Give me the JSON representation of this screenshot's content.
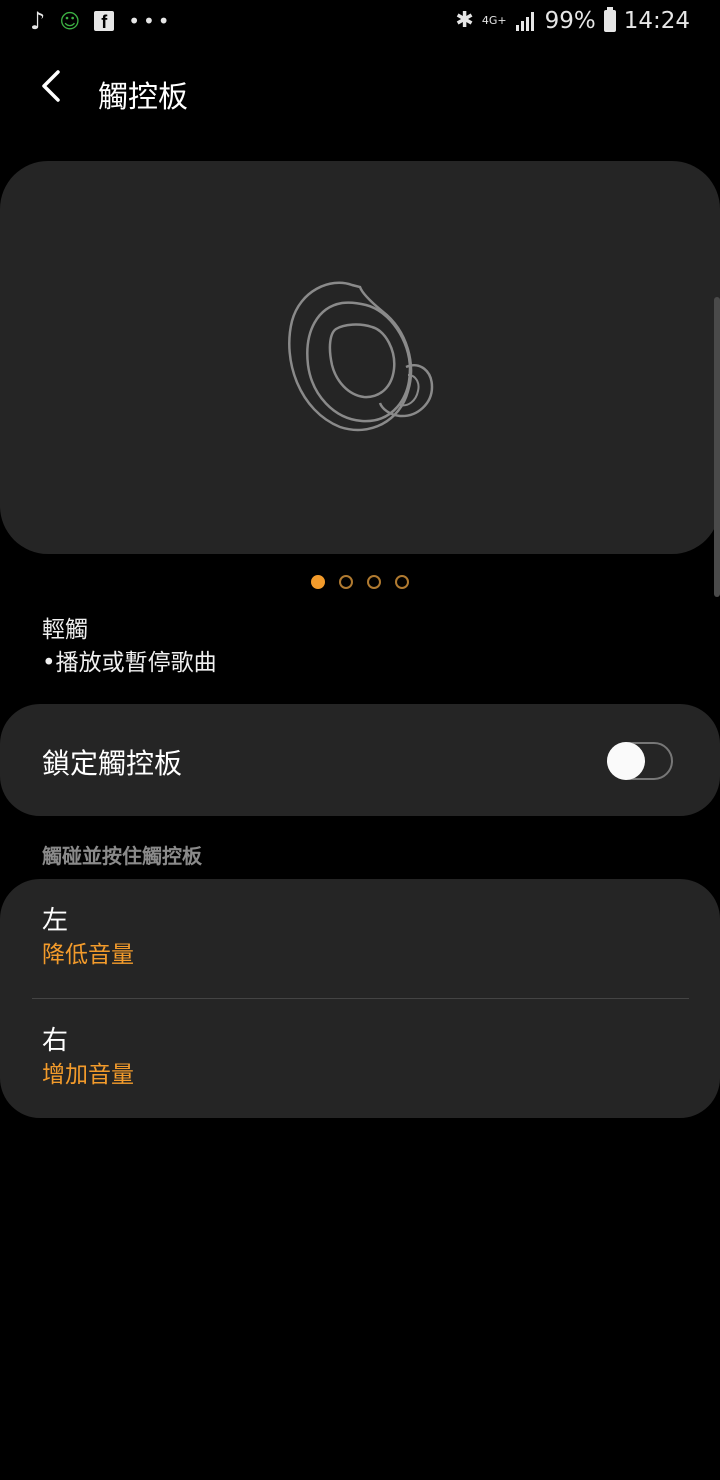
{
  "status_bar": {
    "battery": "99%",
    "time": "14:24",
    "network": "4G+",
    "icons": [
      "music-note-icon",
      "android-icon",
      "facebook-icon",
      "more-dots-icon",
      "bluetooth-icon",
      "signal-icon",
      "battery-icon"
    ]
  },
  "header": {
    "title": "觸控板"
  },
  "gesture": {
    "name": "輕觸",
    "description": "•播放或暫停歌曲",
    "pager_count": 4,
    "pager_active": 0
  },
  "lock": {
    "label": "鎖定觸控板",
    "enabled": false
  },
  "hold_section": {
    "title": "觸碰並按住觸控板",
    "items": [
      {
        "side": "左",
        "action": "降低音量"
      },
      {
        "side": "右",
        "action": "增加音量"
      }
    ]
  },
  "colors": {
    "accent": "#f39b2b",
    "card_bg": "#252525",
    "background": "#000000"
  }
}
